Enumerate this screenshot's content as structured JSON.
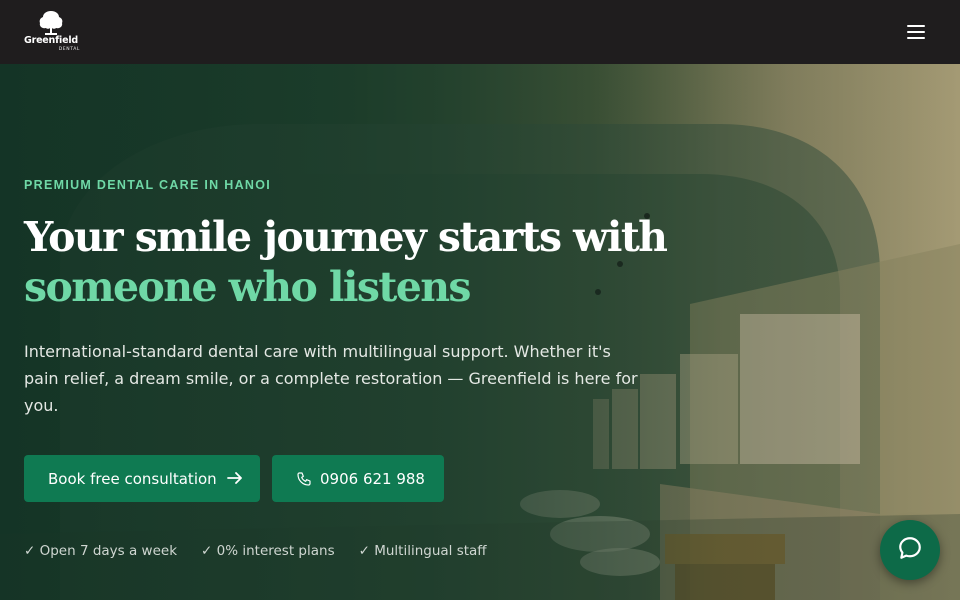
{
  "header": {
    "brand_name": "Greenfield",
    "brand_sub": "DENTAL",
    "logo_icon": "tree-icon",
    "menu_icon": "hamburger-menu-icon"
  },
  "hero": {
    "eyebrow": "PREMIUM DENTAL CARE IN HANOI",
    "headline_line1": "Your smile journey starts with",
    "headline_line2": "someone who listens",
    "lede": "International-standard dental care with multilingual support. Whether it's pain relief, a dream smile, or a complete restoration — Greenfield is here for you.",
    "cta_primary": "Book free consultation",
    "cta_primary_icon": "arrow-right-icon",
    "cta_phone": "0906 621 988",
    "cta_phone_icon": "phone-icon",
    "perks": [
      "✓ Open 7 days a week",
      "✓ 0% interest plans",
      "✓ Multilingual staff"
    ]
  },
  "chat": {
    "icon": "chat-bubble-icon"
  },
  "colors": {
    "accent": "#6fd8a6",
    "button": "#0f7a52",
    "header_bg": "#1f1d1e"
  }
}
